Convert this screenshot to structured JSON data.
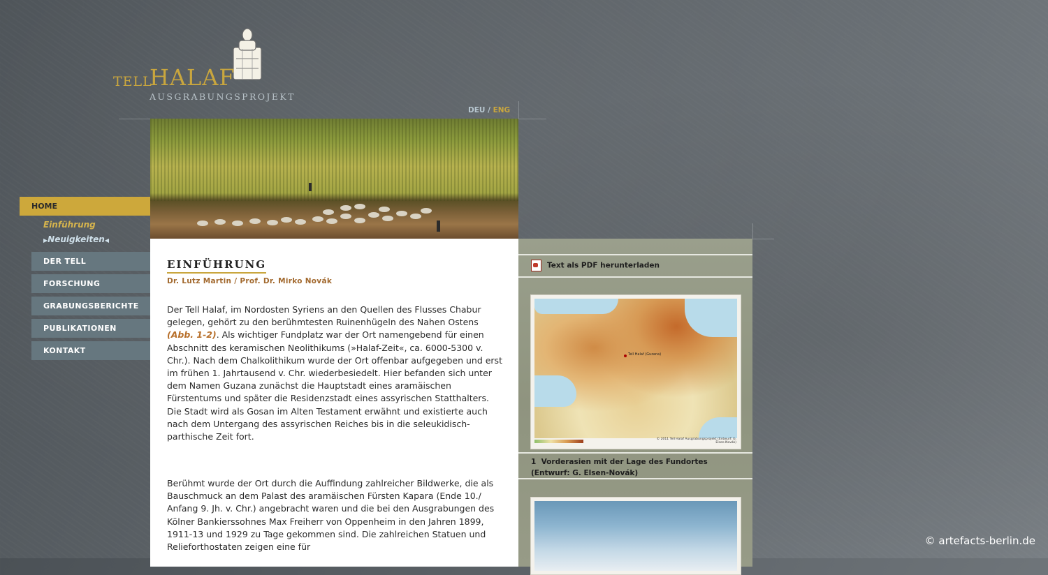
{
  "logo": {
    "tell": "TELL",
    "halaf": "HALAF",
    "subtitle": "AUSGRABUNGSPROJEKT"
  },
  "lang": {
    "deu": "DEU",
    "separator": " / ",
    "eng": "ENG"
  },
  "nav": {
    "home": "HOME",
    "sub_einfuehrung": "Einführung",
    "sub_neuigkeiten": "Neuigkeiten",
    "der_tell": "DER TELL",
    "forschung": "FORSCHUNG",
    "grabungsberichte": "GRABUNGSBERICHTE",
    "publikationen": "PUBLIKATIONEN",
    "kontakt": "KONTAKT"
  },
  "article": {
    "title": "EINFÜHRUNG",
    "authors": "Dr. Lutz Martin / Prof. Dr. Mirko Novák",
    "p1_before": "Der Tell Halaf, im Nordosten Syriens an den Quellen des Flusses Chabur gelegen, gehört zu den berühmtesten Ruinenhügeln des Nahen Ostens ",
    "p1_ref": "(Abb. 1-2)",
    "p1_after": ". Als wichtiger Fundplatz war der Ort namengebend für einen Abschnitt des keramischen Neolithikums (»Halaf-Zeit«, ca. 6000-5300 v. Chr.). Nach dem Chalkolithikum wurde der Ort offenbar aufgegeben und erst im frühen 1. Jahrtausend v. Chr. wiederbesiedelt. Hier befanden sich unter dem Namen Guzana zunächst die Hauptstadt eines aramäischen Fürstentums und später die Residenzstadt eines assyrischen Statthalters. Die Stadt wird als Gosan im Alten Testament erwähnt und existierte auch nach dem Untergang des assyrischen Reiches bis in die seleukidisch-parthische Zeit fort.",
    "p2": "Berühmt wurde der Ort durch die Auffindung zahlreicher Bildwerke, die als Bauschmuck an dem Palast des aramäischen Fürsten Kapara (Ende 10./ Anfang 9. Jh. v. Chr.) angebracht waren und die bei den Ausgrabungen des Kölner Bankierssohnes Max Freiherr von Oppenheim in den Jahren 1899, 1911-13 und 1929 zu Tage gekommen sind. Die zahlreichen Statuen und Reliefortho­staten zeigen eine für"
  },
  "sidebar": {
    "pdf_label": "Text als PDF herunterladen",
    "map_label": "Tell Halaf (Guzana)",
    "map_copyright": "© 2011 Tell Halaf Ausgrabungsprojekt (Entwurf: G. Elsen-Novák)",
    "caption_number": "1",
    "caption_text": "Vorderasien mit der Lage des Fundortes (Entwurf: G. Elsen-Novák)"
  },
  "footer": {
    "credit": "© artefacts-berlin.de"
  },
  "colors": {
    "accent_gold": "#c9a63e",
    "nav_button": "#66777f",
    "ref_orange": "#b76f2a"
  }
}
